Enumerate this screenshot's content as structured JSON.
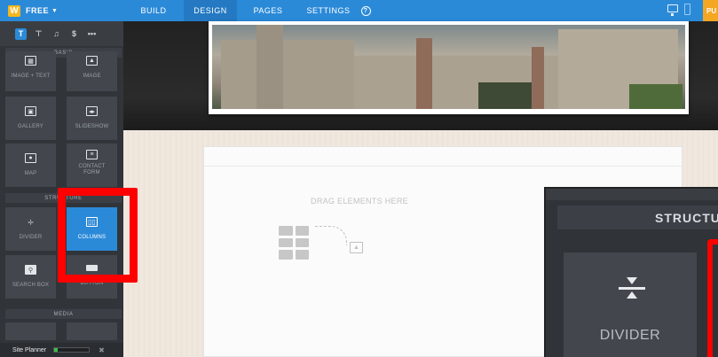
{
  "topbar": {
    "brand_glyph": "W",
    "plan": "FREE",
    "nav": [
      {
        "label": "BUILD"
      },
      {
        "label": "DESIGN"
      },
      {
        "label": "PAGES"
      },
      {
        "label": "SETTINGS"
      }
    ],
    "help_glyph": "?",
    "publish_label": "PU",
    "colors": {
      "bar": "#2b8ad8",
      "active_tab": "#2479c2",
      "publish": "#f5a623"
    }
  },
  "sidebar": {
    "element_tabs": [
      {
        "glyph": "T",
        "active": true
      },
      {
        "glyph": "⊤",
        "active": false
      },
      {
        "glyph": "♫",
        "active": false
      },
      {
        "glyph": "$",
        "active": false
      },
      {
        "glyph": "•••",
        "active": false
      }
    ],
    "categories": {
      "basic": "BASIC",
      "structure": "STRUCTURE",
      "media": "MEDIA"
    },
    "tiles": {
      "image_text": {
        "label": "IMAGE + TEXT",
        "icon": "image-text-icon"
      },
      "image": {
        "label": "IMAGE",
        "icon": "image-icon"
      },
      "gallery": {
        "label": "GALLERY",
        "icon": "gallery-icon"
      },
      "slideshow": {
        "label": "SLIDESHOW",
        "icon": "slideshow-icon"
      },
      "map": {
        "label": "MAP",
        "icon": "map-pin-icon"
      },
      "contact_form": {
        "label": "CONTACT FORM",
        "icon": "form-icon"
      },
      "divider": {
        "label": "DIVIDER",
        "icon": "divider-icon"
      },
      "columns": {
        "label": "COLUMNS",
        "icon": "columns-icon",
        "active": true
      },
      "search_box": {
        "label": "SEARCH BOX",
        "icon": "search-icon"
      },
      "button": {
        "label": "BUTTON",
        "icon": "button-icon"
      }
    },
    "footer": {
      "label": "Site Planner",
      "progress": 0.1,
      "close_glyph": "✖"
    }
  },
  "canvas": {
    "drop_text": "DRAG ELEMENTS HERE"
  },
  "zoom_inset": {
    "header": "STRUCTU",
    "tile_label": "DIVIDER"
  },
  "highlight_color": "#ff0000"
}
